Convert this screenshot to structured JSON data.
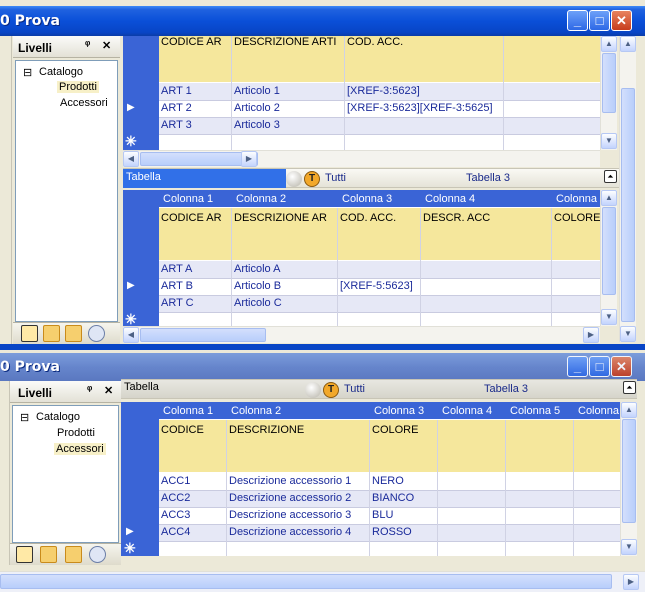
{
  "window1": {
    "title": "0 Prova",
    "levels_panel": {
      "title": "Livelli",
      "pin": "ᵠ",
      "close": "✕",
      "tree": {
        "root": "Catalogo",
        "expander": "⊟",
        "children": [
          "Prodotti",
          "Accessori"
        ],
        "selected": "Prodotti"
      }
    },
    "grid_top": {
      "headers": [
        "CODICE AR",
        "DESCRIZIONE ARTI",
        "COD. ACC."
      ],
      "rows": [
        {
          "code": "ART 1",
          "desc": "Articolo 1",
          "acc": "[XREF-3:5623]"
        },
        {
          "code": "ART 2",
          "desc": "Articolo 2",
          "acc": "[XREF-3:5623][XREF-3:5625]"
        },
        {
          "code": "ART 3",
          "desc": "Articolo 3",
          "acc": ""
        }
      ]
    },
    "tabbar": {
      "selected_tab": "Tabella",
      "filter_label": "Tutti",
      "table_label": "Tabella 3"
    },
    "grid_bottom": {
      "columns": [
        "Colonna 1",
        "Colonna 2",
        "Colonna 3",
        "Colonna 4",
        "Colonna"
      ],
      "headers": [
        "CODICE AR",
        "DESCRIZIONE AR",
        "COD. ACC.",
        "DESCR. ACC",
        "COLORE"
      ],
      "rows": [
        {
          "code": "ART A",
          "desc": "Articolo A",
          "acc": ""
        },
        {
          "code": "ART B",
          "desc": "Articolo B",
          "acc": "[XREF-5:5623]"
        },
        {
          "code": "ART C",
          "desc": "Articolo C",
          "acc": ""
        }
      ]
    }
  },
  "window2": {
    "title": "0 Prova",
    "levels_panel": {
      "title": "Livelli",
      "pin": "ᵠ",
      "close": "✕",
      "tree": {
        "root": "Catalogo",
        "expander": "⊟",
        "children": [
          "Prodotti",
          "Accessori"
        ],
        "selected": "Accessori"
      }
    },
    "tabbar": {
      "selected_tab": "Tabella",
      "filter_label": "Tutti",
      "table_label": "Tabella 3"
    },
    "grid": {
      "columns": [
        "Colonna 1",
        "Colonna 2",
        "Colonna 3",
        "Colonna 4",
        "Colonna 5",
        "Colonna"
      ],
      "headers": [
        "CODICE",
        "DESCRIZIONE",
        "COLORE"
      ],
      "rows": [
        {
          "code": "ACC1",
          "desc": "Descrizione accessorio 1",
          "color": "NERO"
        },
        {
          "code": "ACC2",
          "desc": "Descrizione accessorio 2",
          "color": "BIANCO"
        },
        {
          "code": "ACC3",
          "desc": "Descrizione accessorio 3",
          "color": "BLU"
        },
        {
          "code": "ACC4",
          "desc": "Descrizione accessorio 4",
          "color": "ROSSO"
        }
      ]
    }
  },
  "glyphs": {
    "row_pointer": "▶",
    "new_row": "✳",
    "minimize": "_",
    "maximize": "□",
    "close": "✕",
    "up": "▲",
    "down": "▼",
    "left": "◀",
    "right": "▶",
    "collapse": "⏶",
    "filter_badge": "T"
  },
  "colors": {
    "accent": "#3a64d6",
    "header_yellow": "#f5e79c",
    "titlebar": "#0a4fd8"
  }
}
